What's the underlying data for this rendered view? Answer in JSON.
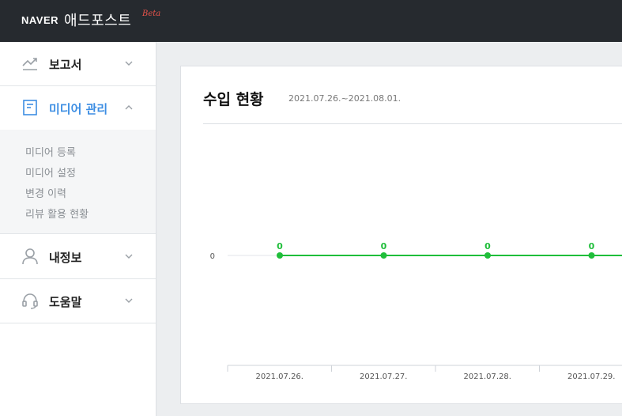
{
  "header": {
    "brand_naver": "NAVER",
    "brand_name": "애드포스트",
    "brand_beta": "Beta"
  },
  "sidebar": {
    "items": [
      {
        "label": "보고서",
        "icon": "trend-chart-icon"
      },
      {
        "label": "미디어 관리",
        "icon": "document-icon",
        "expanded": true
      },
      {
        "label": "내정보",
        "icon": "user-icon"
      },
      {
        "label": "도움말",
        "icon": "headset-icon"
      }
    ],
    "submenu": [
      {
        "label": "미디어 등록"
      },
      {
        "label": "미디어 설정"
      },
      {
        "label": "변경 이력"
      },
      {
        "label": "리뷰 활용 현황"
      }
    ]
  },
  "main": {
    "title": "수입 현황",
    "period": "2021.07.26.~2021.08.01."
  },
  "colors": {
    "topbar": "#262a2f",
    "accent_blue": "#3d8ee3",
    "line_green": "#1fbe3a",
    "beta_red": "#e5534b"
  },
  "chart_data": {
    "type": "line",
    "categories": [
      "2021.07.26.",
      "2021.07.27.",
      "2021.07.28.",
      "2021.07.29."
    ],
    "values": [
      0,
      0,
      0,
      0
    ],
    "y_ticks": [
      "0"
    ],
    "point_labels": [
      "0",
      "0",
      "0",
      "0"
    ],
    "grid": false
  }
}
